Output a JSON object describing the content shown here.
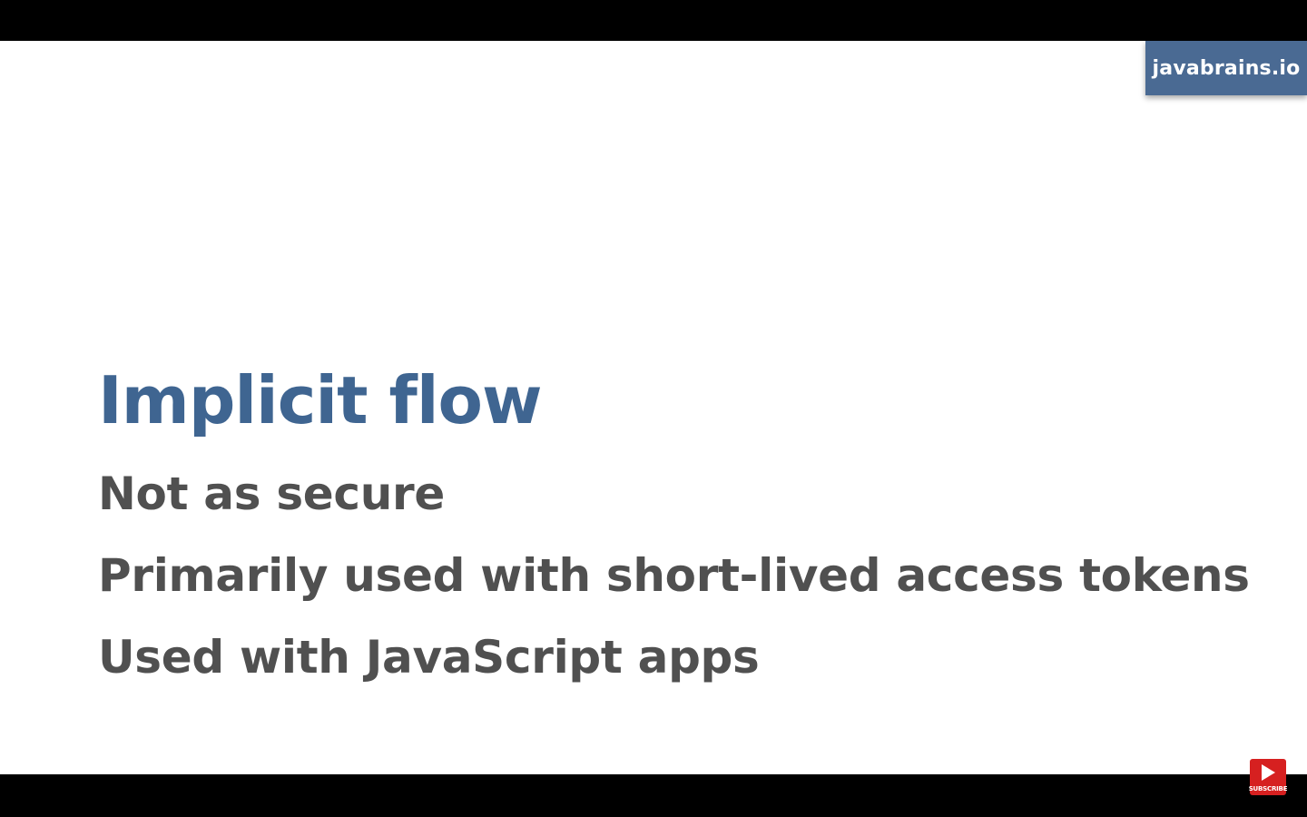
{
  "brand": {
    "label": "javabrains.io",
    "color": "#4a6a93"
  },
  "slide": {
    "title": "Implicit flow",
    "title_color": "#3f6591",
    "bullets": [
      "Not as secure",
      "Primarily used with short-lived access tokens",
      "Used with JavaScript apps"
    ],
    "bullet_color": "#505050"
  },
  "subscribe": {
    "label": "SUBSCRIBE",
    "icon": "play-icon",
    "color": "#d62020"
  }
}
